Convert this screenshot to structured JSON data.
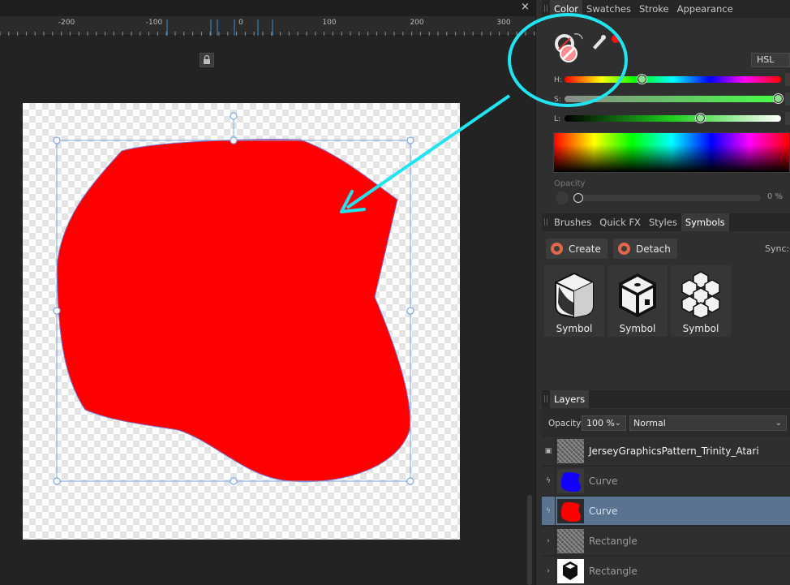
{
  "window": {
    "close_glyph": "×"
  },
  "ruler": {
    "ticks": [
      "-200",
      "-100",
      "0",
      "100",
      "200",
      "300"
    ]
  },
  "color_panel": {
    "tabs": [
      "Color",
      "Swatches",
      "Stroke",
      "Appearance"
    ],
    "active_tab": "Color",
    "model": "HSL",
    "sliders": [
      {
        "label": "H:",
        "value_fraction": 0.36
      },
      {
        "label": "S:",
        "value_fraction": 0.99
      },
      {
        "label": "L:",
        "value_fraction": 0.63
      }
    ],
    "opacity_label": "Opacity",
    "opacity_value": "0 %",
    "accent_fill": "#ff0000",
    "annotation_color": "#22e4f0"
  },
  "symbols_panel": {
    "tabs": [
      "Brushes",
      "Quick FX",
      "Styles",
      "Symbols"
    ],
    "active_tab": "Symbols",
    "create_label": "Create",
    "detach_label": "Detach",
    "sync_label": "Sync:",
    "items": [
      {
        "name": "Symbol",
        "icon": "rounded-cube-icon"
      },
      {
        "name": "Symbol",
        "icon": "dice-cube-icon"
      },
      {
        "name": "Symbol",
        "icon": "cube-cluster-icon"
      }
    ]
  },
  "layers_panel": {
    "tab": "Layers",
    "opacity_label": "Opacity:",
    "opacity_value": "100 %",
    "blend_mode": "Normal",
    "layers": [
      {
        "name": "JerseyGraphicsPattern_Trinity_Atari",
        "thumb": "pattern",
        "selected": false
      },
      {
        "name": "Curve",
        "thumb": "#1400ff",
        "selected": false
      },
      {
        "name": "Curve",
        "thumb": "#ff0000",
        "selected": true
      },
      {
        "name": "Rectangle",
        "thumb": "pattern",
        "selected": false
      },
      {
        "name": "Rectangle",
        "thumb": "cubes",
        "selected": false
      }
    ]
  }
}
